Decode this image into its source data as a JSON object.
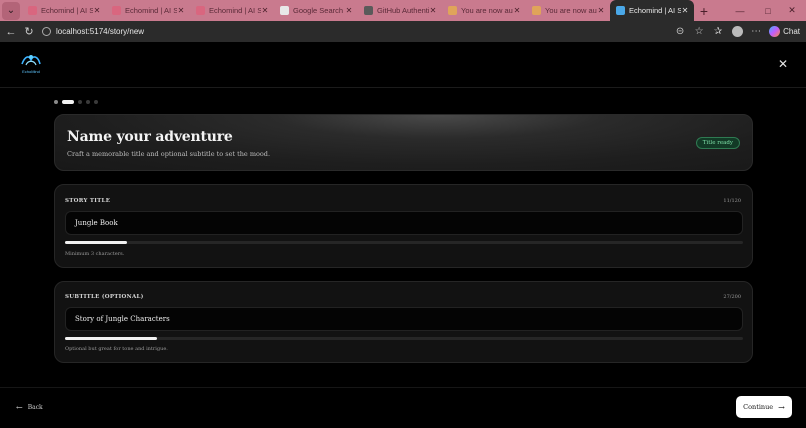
{
  "browser": {
    "tabs": [
      {
        "title": "Echomind | AI Story",
        "favicon_color": "#d9667f"
      },
      {
        "title": "Echomind | AI Story",
        "favicon_color": "#d9667f"
      },
      {
        "title": "Echomind | AI Story",
        "favicon_color": "#d9667f"
      },
      {
        "title": "Google Search - Su",
        "favicon_color": "#e8e8e8"
      },
      {
        "title": "GitHub Authenticat",
        "favicon_color": "#5a5a5a"
      },
      {
        "title": "You are now authe",
        "favicon_color": "#e0a45a"
      },
      {
        "title": "You are now authe",
        "favicon_color": "#e0a45a"
      },
      {
        "title": "Echomind | AI Story",
        "favicon_color": "#4aa8e8"
      }
    ],
    "active_tab_index": 7,
    "url": "localhost:5174/story/new",
    "chat_label": "Chat",
    "chrome_color": "#c97a8e"
  },
  "app": {
    "logo_text": "EchoMind",
    "progress_steps": [
      {
        "state": "done"
      },
      {
        "state": "active"
      },
      {
        "state": "todo"
      },
      {
        "state": "todo"
      },
      {
        "state": "todo"
      }
    ],
    "hero": {
      "title": "Name your adventure",
      "subtitle": "Craft a memorable title and optional subtitle to set the mood.",
      "badge": "Title ready"
    },
    "title_field": {
      "label": "STORY TITLE",
      "count": "11/120",
      "value": "Jungle Book",
      "progress": 0.092,
      "hint": "Minimum 3 characters."
    },
    "subtitle_field": {
      "label": "SUBTITLE (OPTIONAL)",
      "count": "27/200",
      "value": "Story of Jungle Characters",
      "progress": 0.135,
      "hint": "Optional but great for tone and intrigue."
    },
    "footer": {
      "back_label": "Back",
      "continue_label": "Continue"
    }
  }
}
